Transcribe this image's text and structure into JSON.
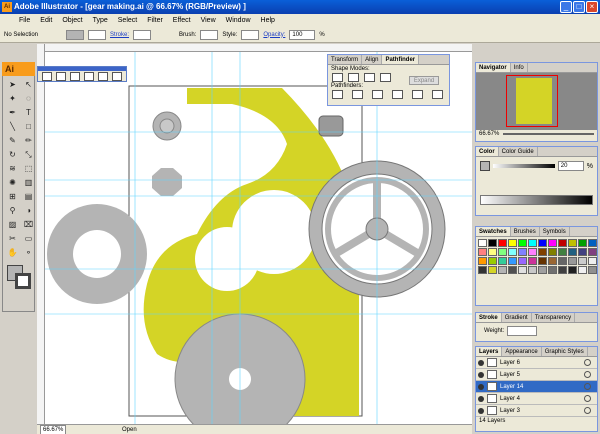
{
  "window": {
    "title": "Adobe Illustrator - [gear making.ai @ 66.67% (RGB/Preview) ]",
    "app_icon": "Ai"
  },
  "menu": [
    "File",
    "Edit",
    "Object",
    "Type",
    "Select",
    "Filter",
    "Effect",
    "View",
    "Window",
    "Help"
  ],
  "control_bar": {
    "selection": "No Selection",
    "stroke_label": "Stroke:",
    "brush_label": "Brush:",
    "style_label": "Style:",
    "opacity_label": "Opacity:",
    "opacity_value": "100",
    "percent": "%"
  },
  "toolbox": {
    "logo": "Ai"
  },
  "pathfinder": {
    "tabs": [
      "Transform",
      "Align",
      "Pathfinder"
    ],
    "shape_modes_label": "Shape Modes:",
    "pathfinders_label": "Pathfinders:",
    "expand_label": "Expand"
  },
  "navigator": {
    "tabs": [
      "Navigator",
      "Info"
    ],
    "zoom": "66.67%"
  },
  "color": {
    "tabs": [
      "Color",
      "Color Guide"
    ],
    "channel_value": "20",
    "percent": "%"
  },
  "swatches": {
    "tabs": [
      "Swatches",
      "Brushes",
      "Symbols"
    ],
    "colors": [
      "#ffffff",
      "#000000",
      "#ff0000",
      "#ffff00",
      "#00ff00",
      "#00ffff",
      "#0000ff",
      "#ff00ff",
      "#c00000",
      "#c0c000",
      "#00a000",
      "#0060c0",
      "#ff8080",
      "#ffff80",
      "#80ff80",
      "#80ffff",
      "#8080ff",
      "#ff80ff",
      "#804000",
      "#808000",
      "#408040",
      "#206080",
      "#404080",
      "#804080",
      "#ff9900",
      "#99cc00",
      "#33cc99",
      "#3399ff",
      "#9966ff",
      "#cc3399",
      "#663300",
      "#996633",
      "#666666",
      "#999999",
      "#cccccc",
      "#eeeeee",
      "#333333",
      "#d4d426",
      "#b4b4b4",
      "#505050",
      "#e0e0e0",
      "#c8c8c8",
      "#a0a0a0",
      "#707070",
      "#404040",
      "#202020",
      "#f0f0f0",
      "#909090"
    ]
  },
  "stroke": {
    "tabs": [
      "Stroke",
      "Gradient",
      "Transparency"
    ],
    "weight_label": "Weight:"
  },
  "layers": {
    "tabs": [
      "Layers",
      "Appearance",
      "Graphic Styles"
    ],
    "rows": [
      {
        "name": "Layer 6",
        "selected": false
      },
      {
        "name": "Layer 5",
        "selected": false
      },
      {
        "name": "Layer 14",
        "selected": true
      },
      {
        "name": "Layer 4",
        "selected": false
      },
      {
        "name": "Layer 3",
        "selected": false
      }
    ],
    "count": "14 Layers"
  },
  "status": {
    "zoom": "66.67%",
    "status_text": "Open"
  },
  "colors": {
    "yellow": "#d4d426",
    "gear": "#b4b4b4",
    "gear_stroke": "#888888",
    "guide": "#5fd6ff"
  }
}
